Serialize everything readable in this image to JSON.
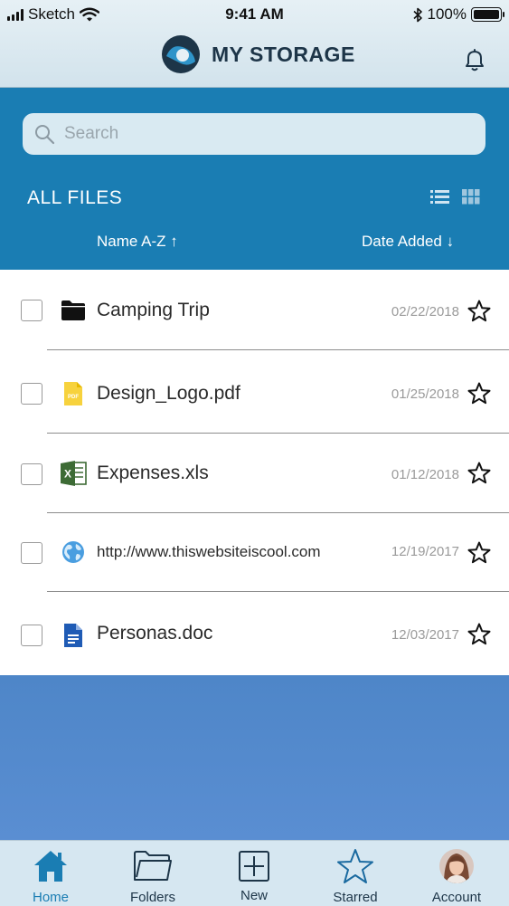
{
  "status_bar": {
    "carrier": "Sketch",
    "time": "9:41 AM",
    "battery": "100%"
  },
  "header": {
    "title": "MY STORAGE"
  },
  "search": {
    "placeholder": "Search"
  },
  "section": {
    "title": "ALL FILES"
  },
  "sort": {
    "name_label": "Name  A-Z ↑",
    "date_label": "Date Added ↓"
  },
  "files": [
    {
      "name": "Camping Trip",
      "date": "02/22/2018",
      "icon": "folder-icon"
    },
    {
      "name": "Design_Logo.pdf",
      "date": "01/25/2018",
      "icon": "pdf-icon"
    },
    {
      "name": "Expenses.xls",
      "date": "01/12/2018",
      "icon": "excel-icon"
    },
    {
      "name": "http://www.thiswebsiteiscool.com",
      "date": "12/19/2017",
      "icon": "globe-icon"
    },
    {
      "name": "Personas.doc",
      "date": "12/03/2017",
      "icon": "document-icon"
    }
  ],
  "tabs": [
    {
      "label": "Home",
      "icon": "home-icon",
      "active": true
    },
    {
      "label": "Folders",
      "icon": "folder-icon"
    },
    {
      "label": "New",
      "icon": "plus-square-icon"
    },
    {
      "label": "Starred",
      "icon": "star-icon"
    },
    {
      "label": "Account",
      "icon": "avatar"
    }
  ],
  "colors": {
    "primary": "#1a7db3",
    "empty_area": "#5a8ed2",
    "tab_bar": "#d6e7f1",
    "header_bg": "#e6f0f5"
  }
}
